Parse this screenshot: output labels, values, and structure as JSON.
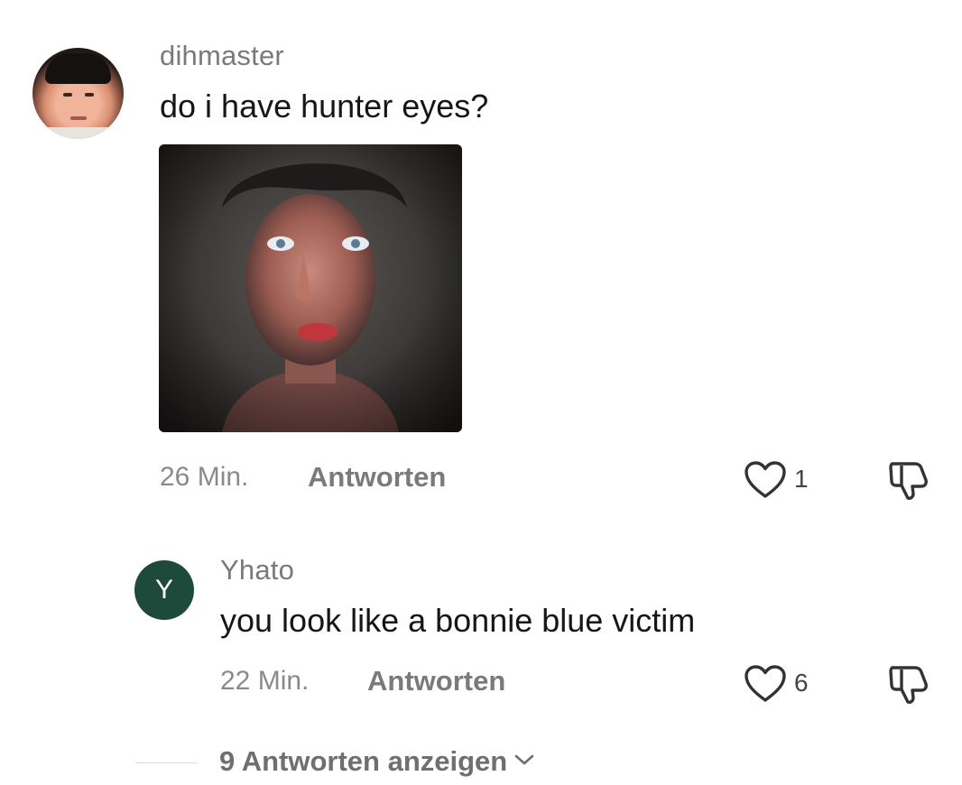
{
  "comment": {
    "username": "dihmaster",
    "text": "do i have hunter eyes?",
    "time": "26 Min.",
    "reply_label": "Antworten",
    "like_count": "1"
  },
  "reply": {
    "avatar_letter": "Y",
    "username": "Yhato",
    "text": "you look like a bonnie blue victim",
    "time": "22 Min.",
    "reply_label": "Antworten",
    "like_count": "6"
  },
  "view_replies": {
    "label": "9 Antworten anzeigen"
  },
  "icons": {
    "like": "heart-outline-icon",
    "dislike": "thumbs-down-outline-icon",
    "expand": "chevron-down-icon"
  },
  "colors": {
    "reply_avatar_bg": "#1e4a3b",
    "text_primary": "#161616",
    "text_secondary": "#7a7a7a"
  }
}
